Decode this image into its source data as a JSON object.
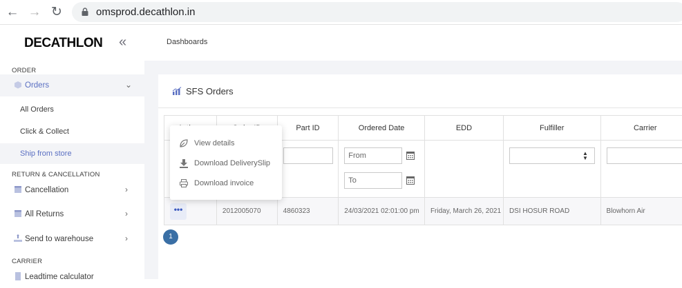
{
  "browser": {
    "url": "omsprod.decathlon.in"
  },
  "sidebar": {
    "logo": "DECATHLON",
    "collapse_icon": "«",
    "section_order": "ORDER",
    "orders_label": "Orders",
    "sub_items": [
      "All Orders",
      "Click & Collect",
      "Ship from store"
    ],
    "section_return": "RETURN & CANCELLATION",
    "cancellation": "Cancellation",
    "all_returns": "All Returns",
    "send_to_warehouse": "Send to warehouse",
    "section_carrier": "CARRIER",
    "leadtime": "Leadtime calculator"
  },
  "header": {
    "breadcrumb": "Dashboards"
  },
  "card": {
    "title": "SFS Orders"
  },
  "table": {
    "headers": [
      "Actions",
      "Order ID",
      "Part ID",
      "Ordered Date",
      "EDD",
      "Fulfiller",
      "Carrier"
    ],
    "filters": {
      "date_from": "From",
      "date_to": "To"
    },
    "row": {
      "actions": "•••",
      "order_id": "2012005070",
      "part_id": "4860323",
      "ordered_date": "24/03/2021 02:01:00 pm",
      "edd": "Friday, March 26, 2021",
      "fulfiller": "DSI HOSUR ROAD",
      "carrier": "Blowhorn Air"
    }
  },
  "menu": {
    "items": [
      "View details",
      "Download DeliverySlip",
      "Download invoice"
    ]
  },
  "pagination": {
    "current": "1"
  },
  "colors": {
    "accent": "#5a6fc2",
    "pager": "#3a6fa5",
    "bg": "#f3f4f7"
  }
}
